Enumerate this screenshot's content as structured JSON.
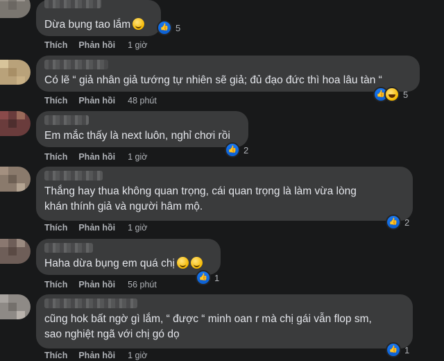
{
  "labels": {
    "like": "Thích",
    "reply": "Phản hồi"
  },
  "comments": [
    {
      "lines": [
        "Dừa bụng tao lắm"
      ],
      "reaction_count": "5",
      "time": "1 giờ"
    },
    {
      "lines": [
        "Có lẽ “ giả nhân giả tướng tự nhiên sẽ giả; đủ đạo đức thì hoa lâu tàn “"
      ],
      "reaction_count": "5",
      "time": "48 phút"
    },
    {
      "lines": [
        "Em mắc thấy là next luôn, nghỉ chơi rồi"
      ],
      "reaction_count": "2",
      "time": "1 giờ"
    },
    {
      "lines": [
        "Thắng hay thua không quan trọng, cái quan trọng là làm vừa lòng",
        "khán thính giả và người hâm mộ."
      ],
      "reaction_count": "2",
      "time": "1 giờ"
    },
    {
      "lines": [
        "Haha dừa bụng em quá chị"
      ],
      "reaction_count": "1",
      "time": "56 phút"
    },
    {
      "lines": [
        "cũng hok bất ngờ gì lắm, “ được “ minh oan r mà chị gái vẫn flop sm,",
        "sao nghiệt ngã với chị gó dọ"
      ],
      "reaction_count": "1",
      "time": "1 giờ"
    }
  ],
  "icons": {
    "like": "like-reaction-icon",
    "haha": "haha-reaction-icon",
    "emoji": "laughing-emoji-icon"
  },
  "colors": {
    "background": "#18191a",
    "bubble": "#3a3b3c",
    "text": "#e4e6eb",
    "secondary_text": "#b0b3b8",
    "like_blue": "#1877f2"
  }
}
